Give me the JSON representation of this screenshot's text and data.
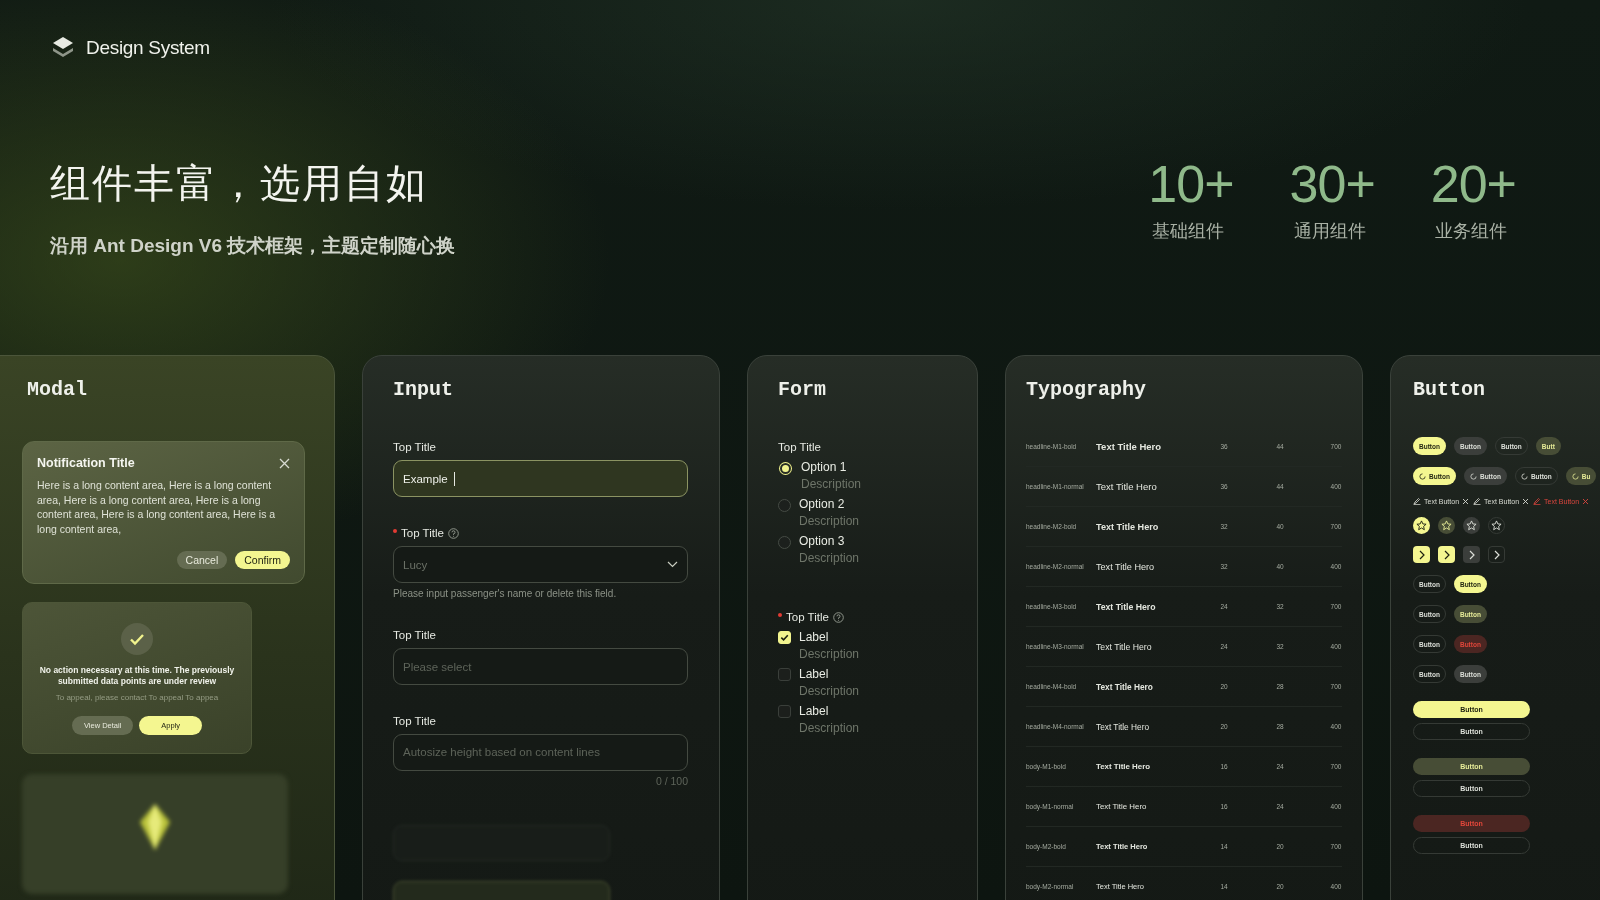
{
  "brand": {
    "name": "Design System"
  },
  "hero": {
    "title": "组件丰富，选用自如",
    "subtitle": "沿用 Ant Design V6 技术框架，主题定制随心换"
  },
  "stats": [
    {
      "value": "10+",
      "label": "基础组件"
    },
    {
      "value": "30+",
      "label": "通用组件"
    },
    {
      "value": "20+",
      "label": "业务组件"
    }
  ],
  "modal_card": {
    "title": "Modal",
    "notification": {
      "title": "Notification Title",
      "body": "Here is a long content area, Here is a long content area,  Here is a long content area, Here is a long content area, Here is a long content area, Here is a long content area,",
      "buttons": [
        {
          "label": "Cancel",
          "kind": "secondary"
        },
        {
          "label": "Confirm",
          "kind": "primary"
        }
      ]
    },
    "result": {
      "message": "No action necessary at this time. The previously submitted data points are under review",
      "note": "To appeal, please contact To appeal To appea",
      "buttons": [
        {
          "label": "View Detail",
          "kind": "secondary"
        },
        {
          "label": "Apply",
          "kind": "primary"
        }
      ]
    }
  },
  "input_card": {
    "title": "Input",
    "fields": [
      {
        "kind": "text",
        "label": "Top Title",
        "value": "Example",
        "focused": true,
        "required": false
      },
      {
        "kind": "select",
        "label": "Top Title",
        "placeholder": "Lucy",
        "required": true,
        "focused": false,
        "hint": "Please input passenger's name or delete this field."
      },
      {
        "kind": "text",
        "label": "Top Title",
        "placeholder": "Please select",
        "focused": false,
        "required": false
      },
      {
        "kind": "textarea",
        "label": "Top Title",
        "placeholder": "Autosize height based on content lines",
        "focused": false,
        "required": false,
        "count": "0 / 100"
      }
    ]
  },
  "form_card": {
    "title": "Form",
    "radio_group": {
      "label": "Top Title",
      "options": [
        {
          "label": "Option 1",
          "description": "Description",
          "selected": true
        },
        {
          "label": "Option 2",
          "description": "Description",
          "selected": false
        },
        {
          "label": "Option 3",
          "description": "Description",
          "selected": false
        }
      ]
    },
    "checkbox_group": {
      "label": "Top Title",
      "required": true,
      "items": [
        {
          "label": "Label",
          "description": "Description",
          "checked": true
        },
        {
          "label": "Label",
          "description": "Description",
          "checked": false
        },
        {
          "label": "Label",
          "description": "Description",
          "checked": false
        }
      ]
    }
  },
  "typography_card": {
    "title": "Typography",
    "rows": [
      {
        "name": "headline-M1-bold",
        "sample": "Text Title Hero",
        "bold": true,
        "column_3": "36",
        "column_4": "44",
        "column_5": "700"
      },
      {
        "name": "headline-M1-normal",
        "sample": "Text Title Hero",
        "bold": false,
        "column_3": "36",
        "column_4": "44",
        "column_5": "400"
      },
      {
        "name": "headline-M2-bold",
        "sample": "Text Title Hero",
        "bold": true,
        "column_3": "32",
        "column_4": "40",
        "column_5": "700"
      },
      {
        "name": "headline-M2-normal",
        "sample": "Text Title Hero",
        "bold": false,
        "column_3": "32",
        "column_4": "40",
        "column_5": "400"
      },
      {
        "name": "headline-M3-bold",
        "sample": "Text Title Hero",
        "bold": true,
        "column_3": "24",
        "column_4": "32",
        "column_5": "700"
      },
      {
        "name": "headline-M3-normal",
        "sample": "Text Title Hero",
        "bold": false,
        "column_3": "24",
        "column_4": "32",
        "column_5": "400"
      },
      {
        "name": "headline-M4-bold",
        "sample": "Text Title Hero",
        "bold": true,
        "column_3": "20",
        "column_4": "28",
        "column_5": "700"
      },
      {
        "name": "headline-M4-normal",
        "sample": "Text Title Hero",
        "bold": false,
        "column_3": "20",
        "column_4": "28",
        "column_5": "400"
      },
      {
        "name": "body-M1-bold",
        "sample": "Text Title Hero",
        "bold": true,
        "column_3": "16",
        "column_4": "24",
        "column_5": "700"
      },
      {
        "name": "body-M1-normal",
        "sample": "Text Title Hero",
        "bold": false,
        "column_3": "16",
        "column_4": "24",
        "column_5": "400"
      },
      {
        "name": "body-M2-bold",
        "sample": "Text Title Hero",
        "bold": true,
        "column_3": "14",
        "column_4": "20",
        "column_5": "700"
      },
      {
        "name": "body-M2-normal",
        "sample": "Text Title Hero",
        "bold": false,
        "column_3": "14",
        "column_4": "20",
        "column_5": "400"
      }
    ]
  },
  "button_card": {
    "title": "Button",
    "rows": [
      {
        "kind": "pill",
        "buttons": [
          {
            "kind": "primary",
            "label": "Button",
            "loading": false
          },
          {
            "kind": "gray",
            "label": "Button",
            "loading": false
          },
          {
            "kind": "outline",
            "label": "Button",
            "loading": false
          },
          {
            "kind": "olive",
            "label": "Butt",
            "loading": false
          }
        ]
      },
      {
        "kind": "pill",
        "buttons": [
          {
            "kind": "primary",
            "label": "Button",
            "loading": true
          },
          {
            "kind": "gray",
            "label": "Button",
            "loading": true
          },
          {
            "kind": "outline",
            "label": "Button",
            "loading": true
          },
          {
            "kind": "olive",
            "label": "Bu",
            "loading": true
          }
        ]
      },
      {
        "kind": "text",
        "buttons": [
          {
            "kind": "plain",
            "label": "Text Button"
          },
          {
            "kind": "plain",
            "label": "Text Button"
          },
          {
            "kind": "danger",
            "label": "Text Button"
          }
        ]
      },
      {
        "kind": "circle",
        "buttons": [
          {
            "kind": "primary"
          },
          {
            "kind": "olive"
          },
          {
            "kind": "gray"
          },
          {
            "kind": "outline"
          }
        ]
      },
      {
        "kind": "square",
        "buttons": [
          {
            "kind": "primary"
          },
          {
            "kind": "primary"
          },
          {
            "kind": "gray"
          },
          {
            "kind": "outline"
          }
        ]
      },
      {
        "kind": "pill",
        "buttons": [
          {
            "kind": "outline",
            "label": "Button"
          },
          {
            "kind": "primary",
            "label": "Button"
          }
        ]
      },
      {
        "kind": "pill",
        "buttons": [
          {
            "kind": "outline",
            "label": "Button"
          },
          {
            "kind": "olive",
            "label": "Button"
          }
        ]
      },
      {
        "kind": "pill",
        "buttons": [
          {
            "kind": "outline",
            "label": "Button"
          },
          {
            "kind": "danger",
            "label": "Button"
          }
        ]
      },
      {
        "kind": "pill",
        "buttons": [
          {
            "kind": "outline",
            "label": "Button"
          },
          {
            "kind": "gray",
            "label": "Button"
          }
        ]
      },
      {
        "kind": "wide",
        "buttons": [
          {
            "kind": "primary",
            "label": "Button"
          },
          {
            "kind": "outline",
            "label": "Button"
          }
        ]
      },
      {
        "kind": "wide",
        "buttons": [
          {
            "kind": "olive",
            "label": "Button"
          },
          {
            "kind": "outline",
            "label": "Button"
          }
        ]
      },
      {
        "kind": "wide",
        "buttons": [
          {
            "kind": "danger",
            "label": "Button"
          },
          {
            "kind": "outline",
            "label": "Button"
          }
        ]
      }
    ]
  }
}
